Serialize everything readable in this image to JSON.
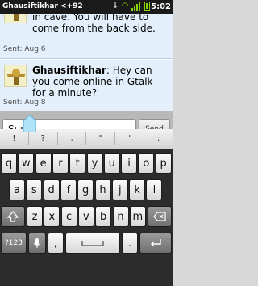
{
  "status_bar": {
    "title": "Ghausiftikhar <+92",
    "time": "5:02",
    "icons": [
      "download-icon",
      "wifi-icon",
      "signal-icon",
      "battery-icon"
    ],
    "accent_color": "#8ad400"
  },
  "messages": [
    {
      "text": "in cave. You will have to come from the back side.",
      "sent": "Sent: Aug 6"
    },
    {
      "sender": "Ghausiftikhar",
      "text": ": Hey can you come online in Gtalk for a minute?",
      "sent": "Sent: Aug 8"
    }
  ],
  "composer": {
    "input_value": "Sure.",
    "send_label": "Send"
  },
  "keyboard": {
    "suggestions": [
      "!",
      "?",
      ",",
      "\"",
      "'",
      ":"
    ],
    "row1": [
      "q",
      "w",
      "e",
      "r",
      "t",
      "y",
      "u",
      "i",
      "o",
      "p"
    ],
    "row2": [
      "a",
      "s",
      "d",
      "f",
      "g",
      "h",
      "j",
      "k",
      "l"
    ],
    "row3": [
      "z",
      "x",
      "c",
      "v",
      "b",
      "n",
      "m"
    ],
    "bottom": {
      "symbols": "?123",
      "comma": ",",
      "period": "."
    },
    "icons": [
      "shift-icon",
      "delete-icon",
      "mic-icon",
      "space-icon",
      "return-icon"
    ]
  }
}
